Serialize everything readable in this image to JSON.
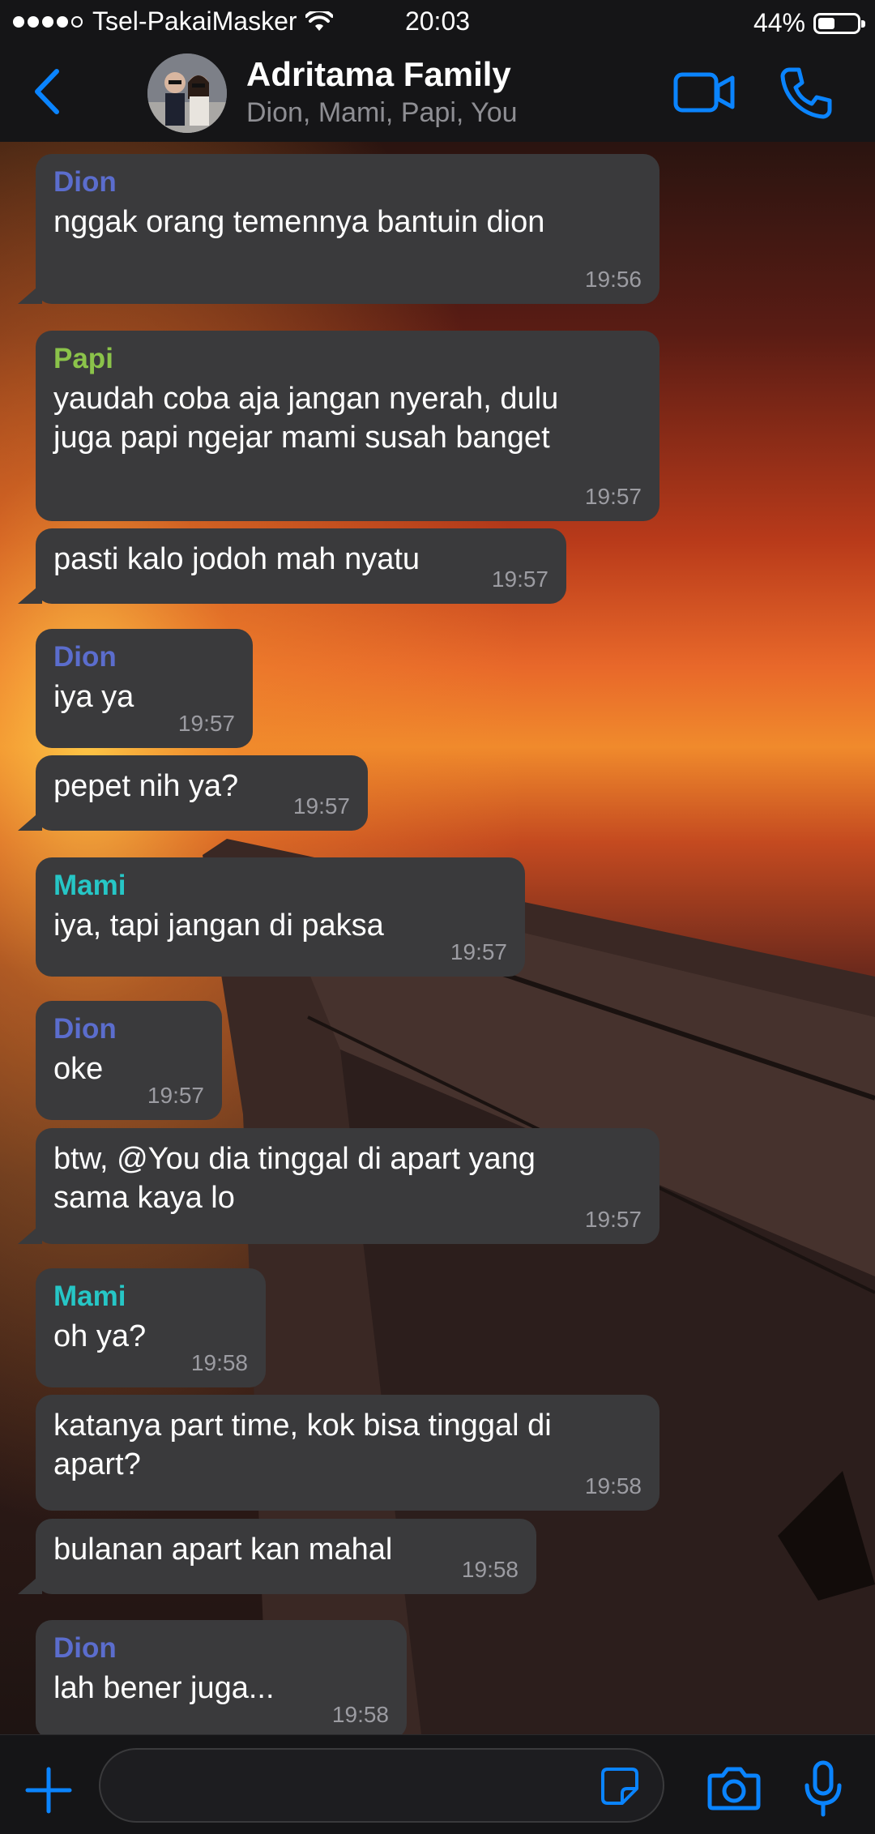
{
  "status_bar": {
    "carrier": "Tsel-PakaiMasker",
    "time": "20:03",
    "battery": "44%",
    "battery_level": 0.44
  },
  "header": {
    "title": "Adritama Family",
    "subtitle": "Dion, Mami, Papi, You"
  },
  "colors": {
    "accent": "#0a84ff",
    "bubble": "#3a3a3c",
    "bar": "#151517",
    "sender_dion": "#5b6dcd",
    "sender_papi": "#8bc34a",
    "sender_mami": "#26c6c6"
  },
  "messages": [
    {
      "sender": "Dion",
      "text": [
        "nggak orang temennya bantuin dion"
      ],
      "time": "19:56"
    },
    {
      "sender": "Papi",
      "text": [
        "yaudah coba aja jangan nyerah, dulu",
        "juga papi ngejar mami susah banget"
      ],
      "time": "19:57"
    },
    {
      "sender": "",
      "text": [
        "pasti kalo jodoh mah nyatu"
      ],
      "time": "19:57"
    },
    {
      "sender": "Dion",
      "text": [
        "iya ya"
      ],
      "time": "19:57"
    },
    {
      "sender": "",
      "text": [
        "pepet nih ya?"
      ],
      "time": "19:57"
    },
    {
      "sender": "Mami",
      "text": [
        "iya, tapi jangan di paksa"
      ],
      "time": "19:57"
    },
    {
      "sender": "Dion",
      "text": [
        "oke"
      ],
      "time": "19:57"
    },
    {
      "sender": "",
      "text": [
        "btw, @You dia tinggal di apart yang",
        "sama kaya lo"
      ],
      "time": "19:57"
    },
    {
      "sender": "Mami",
      "text": [
        "oh ya?"
      ],
      "time": "19:58"
    },
    {
      "sender": "",
      "text": [
        "katanya part time, kok bisa tinggal di",
        "apart?"
      ],
      "time": "19:58"
    },
    {
      "sender": "",
      "text": [
        "bulanan apart kan mahal"
      ],
      "time": "19:58"
    },
    {
      "sender": "Dion",
      "text": [
        "lah bener juga..."
      ],
      "time": "19:58"
    }
  ],
  "icons": {
    "back": "chevron-left-icon",
    "video": "video-camera-icon",
    "call": "phone-icon",
    "attach": "plus-icon",
    "sticker": "sticker-icon",
    "camera": "camera-icon",
    "mic": "microphone-icon"
  }
}
